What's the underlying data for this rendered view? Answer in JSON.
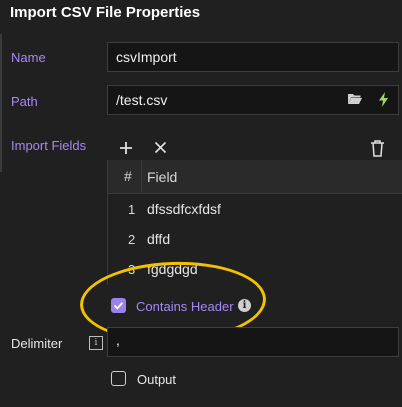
{
  "dialog": {
    "title": "Import CSV File Properties"
  },
  "name": {
    "label": "Name",
    "value": "csvImport"
  },
  "path": {
    "label": "Path",
    "value": "/test.csv",
    "folder_icon": "folder-open-icon",
    "action_icon": "lightning-icon"
  },
  "import_fields": {
    "label": "Import Fields",
    "columns": {
      "num": "#",
      "field": "Field"
    },
    "rows": [
      {
        "num": "1",
        "field": "dfssdfcxfdsf"
      },
      {
        "num": "2",
        "field": "dffd"
      },
      {
        "num": "3",
        "field": "fgdgdgd"
      }
    ],
    "contains_header": {
      "label": "Contains Header",
      "checked": true
    }
  },
  "delimiter": {
    "label": "Delimiter",
    "value": ","
  },
  "output": {
    "label": "Output",
    "checked": false
  },
  "colors": {
    "accent": "#a688f5",
    "checkbox": "#9a82ee",
    "highlight": "#f2c200",
    "background": "#202020"
  }
}
